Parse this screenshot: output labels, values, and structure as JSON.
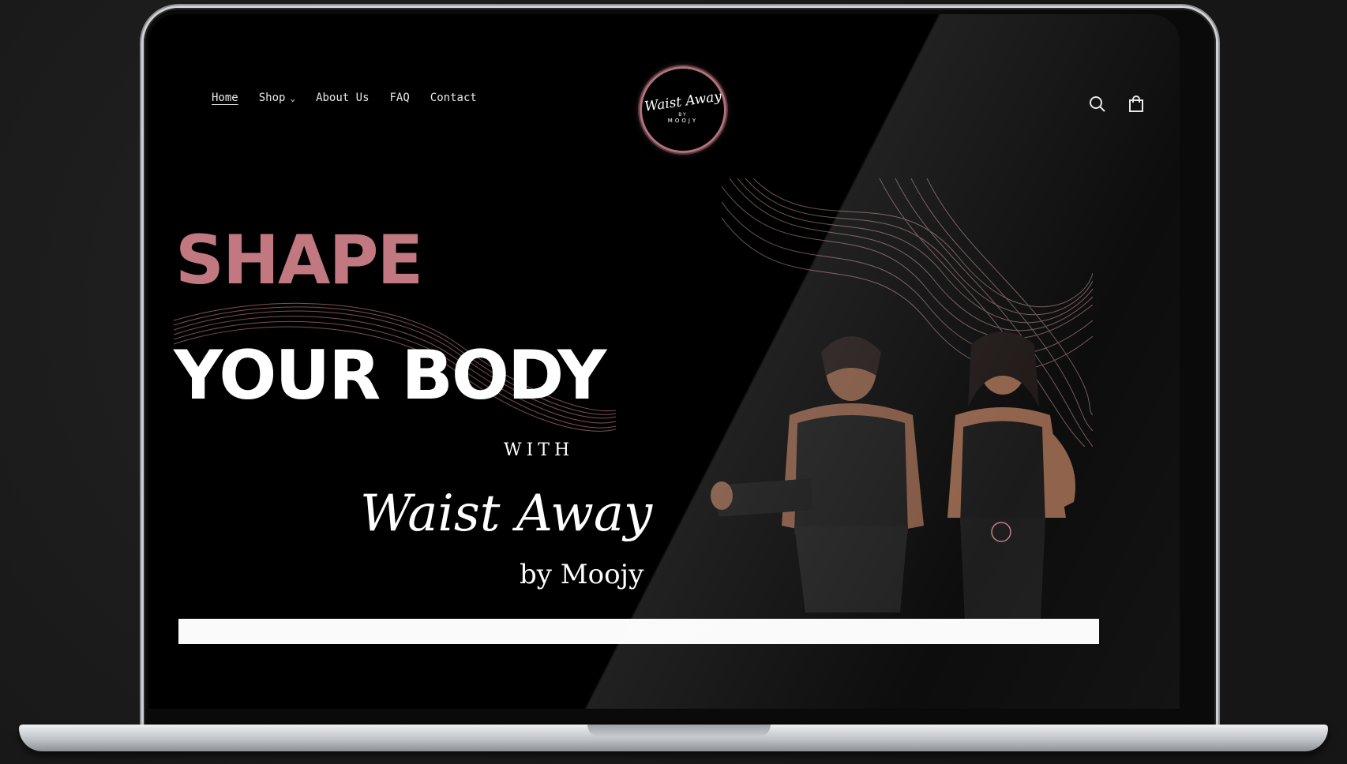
{
  "nav": {
    "items": [
      {
        "label": "Home",
        "active": true
      },
      {
        "label": "Shop",
        "dropdown": true
      },
      {
        "label": "About Us"
      },
      {
        "label": "FAQ"
      },
      {
        "label": "Contact"
      }
    ]
  },
  "logo": {
    "script": "Waist Away",
    "by": "BY",
    "name": "MOOJY"
  },
  "header_icons": [
    "search-icon",
    "cart-icon"
  ],
  "hero": {
    "line1": "SHAPE",
    "line2": "YOUR BODY",
    "with": "WITH",
    "brand": "Waist Away",
    "by": "by Moojy"
  },
  "colors": {
    "accent": "#c27880",
    "background": "#000000",
    "text": "#ffffff"
  }
}
